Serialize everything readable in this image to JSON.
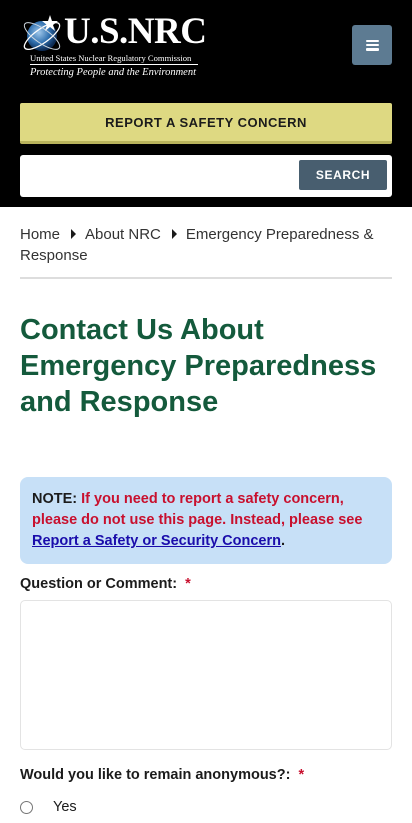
{
  "header": {
    "logo_title": "U.S.NRC",
    "logo_subtitle": "United States Nuclear Regulatory Commission",
    "logo_tagline": "Protecting People and the Environment",
    "menu_icon": "hamburger-menu-icon",
    "report_button": "REPORT A SAFETY CONCERN",
    "search_placeholder": "",
    "search_button": "SEARCH"
  },
  "breadcrumb": {
    "items": [
      "Home",
      "About NRC",
      "Emergency Preparedness & Response"
    ],
    "separator_icon": "caret-right-icon"
  },
  "page": {
    "title": "Contact Us About Emergency Preparedness and Response"
  },
  "note": {
    "label": "NOTE:",
    "text": "If you need to report a safety concern, please do not use this page. Instead, please see",
    "link": "Report a Safety or Security Concern",
    "after_link": "."
  },
  "form": {
    "question_label": "Question or Comment:",
    "required_marker": "*",
    "question_value": "",
    "anonymous_label": "Would you like to remain anonymous?:",
    "options": [
      "Yes"
    ]
  },
  "colors": {
    "header_bg": "#000000",
    "report_button_bg": "#ded982",
    "search_button_bg": "#485e6f",
    "menu_button_bg": "#5d7b92",
    "title_color": "#145a3c",
    "note_bg": "#c7e0f7",
    "alert_red": "#c8102e"
  }
}
